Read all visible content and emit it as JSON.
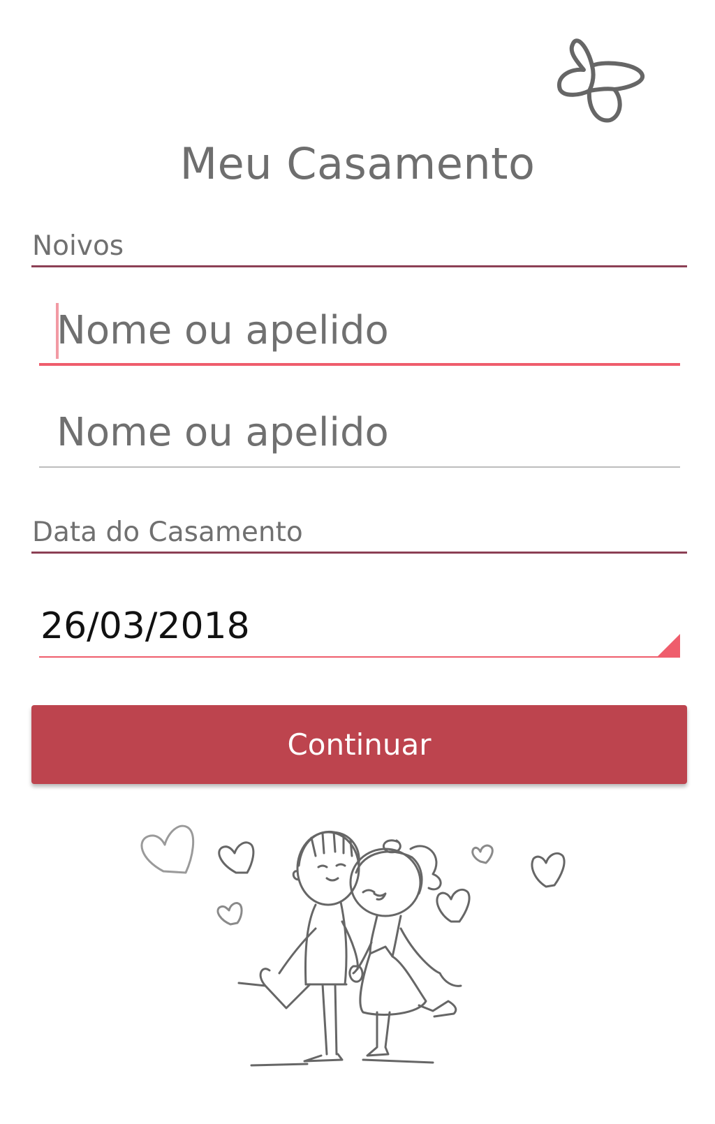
{
  "app": {
    "title": "Meu Casamento"
  },
  "noivos": {
    "section_label": "Noivos",
    "field1": {
      "value": "",
      "placeholder": "Nome ou apelido"
    },
    "field2": {
      "value": "",
      "placeholder": "Nome ou apelido"
    }
  },
  "data_casamento": {
    "section_label": "Data do Casamento",
    "value": "26/03/2018"
  },
  "actions": {
    "continue_label": "Continuar"
  },
  "icons": {
    "top_right": "butterfly-icon",
    "illustration": "couple-illustration"
  },
  "colors": {
    "accent": "#ef5d6c",
    "button": "#bd444e",
    "section_rule": "#8c4055",
    "text_gray": "#6e6e6e"
  }
}
